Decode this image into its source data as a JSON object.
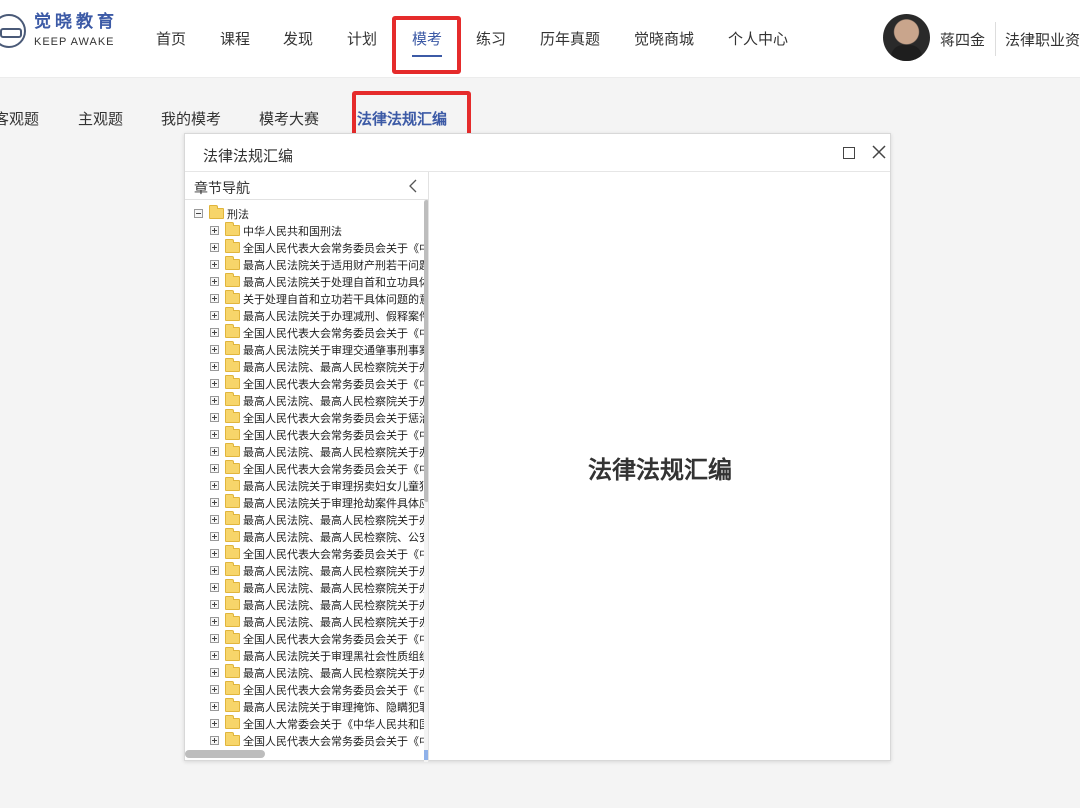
{
  "brand": {
    "name_cn": "觉晓教育",
    "name_en": "KEEP AWAKE",
    "color": "#3c5aa6"
  },
  "nav": {
    "items": [
      "首页",
      "课程",
      "发现",
      "计划",
      "模考",
      "练习",
      "历年真题",
      "觉晓商城",
      "个人中心"
    ],
    "active_index": 4
  },
  "user": {
    "name": "蒋四金",
    "role": "法律职业资"
  },
  "subnav": {
    "items": [
      "客观题",
      "主观题",
      "我的模考",
      "模考大赛",
      "法律法规汇编"
    ],
    "active_index": 4
  },
  "annotation": {
    "highlight_color": "#e52b2b"
  },
  "modal": {
    "title": "法律法规汇编",
    "pane_title": "章节导航",
    "content_title": "法律法规汇编",
    "tree": {
      "root": "刑法",
      "children": [
        "中华人民共和国刑法",
        "全国人民代表大会常务委员会关于《中",
        "最高人民法院关于适用财产刑若干问题",
        "最高人民法院关于处理自首和立功具体",
        "关于处理自首和立功若干具体问题的意",
        "最高人民法院关于办理减刑、假释案件",
        "全国人民代表大会常务委员会关于《中",
        "最高人民法院关于审理交通肇事刑事案",
        "最高人民法院、最高人民检察院关于办",
        "全国人民代表大会常务委员会关于《中",
        "最高人民法院、最高人民检察院关于办",
        "全国人民代表大会常务委员会关于惩治",
        "全国人民代表大会常务委员会关于《中",
        "最高人民法院、最高人民检察院关于办",
        "全国人民代表大会常务委员会关于《中",
        "最高人民法院关于审理拐卖妇女儿童犯",
        "最高人民法院关于审理抢劫案件具体应",
        "最高人民法院、最高人民检察院关于办",
        "最高人民法院、最高人民检察院、公安",
        "全国人民代表大会常务委员会关于《中",
        "最高人民法院、最高人民检察院关于办",
        "最高人民法院、最高人民检察院关于办",
        "最高人民法院、最高人民检察院关于办",
        "最高人民法院、最高人民检察院关于办",
        "全国人民代表大会常务委员会关于《中",
        "最高人民法院关于审理黑社会性质组织",
        "最高人民法院、最高人民检察院关于办",
        "全国人民代表大会常务委员会关于《中",
        "最高人民法院关于审理掩饰、隐瞒犯罪",
        "全国人大常委会关于《中华人民共和国",
        "全国人民代表大会常务委员会关于《中"
      ]
    }
  }
}
